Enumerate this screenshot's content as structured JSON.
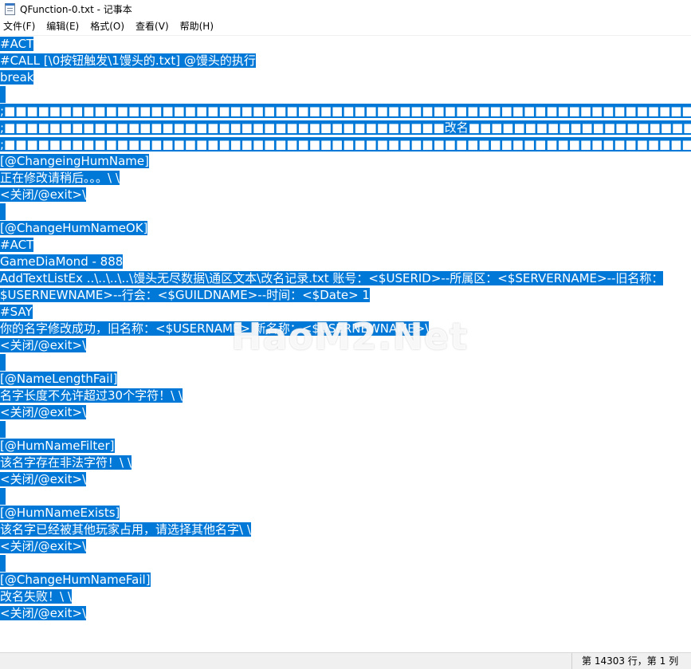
{
  "window": {
    "title": "QFunction-0.txt - 记事本"
  },
  "menu": [
    "文件(F)",
    "编辑(E)",
    "格式(O)",
    "查看(V)",
    "帮助(H)"
  ],
  "lines": [
    "#ACT",
    "#CALL [\\0按钮触发\\1馒头的.txt] @馒头的执行",
    "break",
    "",
    ";■■■■■■■■■■■■■■■■■■■■■■■■■■■■■■■■■■■■■■■■■■■■■■■■■■■■■■■■■■■■■■■■■■■■■■■■■■■■■■■■",
    ";■■■■■■■■■■■■■■■■■■■■■■■■■■■■■■■■■■■■■■■改名■■■■■■■■■■■■■■■■■■■■■■■■■■■■■■■■■■■■■",
    ";■■■■■■■■■■■■■■■■■■■■■■■■■■■■■■■■■■■■■■■■■■■■■■■■■■■■■■■■■■■■■■■■■■■■■■■■■■■■■■■■",
    "[@ChangeingHumName]",
    "正在修改请稍后。。。\\ \\",
    "<关闭/@exit>\\",
    "",
    "[@ChangeHumNameOK]",
    "#ACT",
    "GameDiaMond - 888",
    "AddTextListEx ..\\..\\..\\..\\馒头无尽数据\\通区文本\\改名记录.txt 账号：<$USERID>--所属区：<$SERVERNAME>--旧名称：",
    "$USERNEWNAME>--行会：<$GUILDNAME>--时间：<$Date> 1",
    "#SAY",
    "你的名字修改成功，旧名称：<$USERNAME> 新名称：<$USERNEWNAME>\\",
    "<关闭/@exit>\\",
    "",
    "[@NameLengthFail]",
    "名字长度不允许超过30个字符！\\ \\",
    "<关闭/@exit>\\",
    "",
    "[@HumNameFilter]",
    "该名字存在非法字符！\\ \\",
    "<关闭/@exit>\\",
    "",
    "[@HumNameExists]",
    "该名字已经被其他玩家占用，请选择其他名字\\ \\",
    "<关闭/@exit>\\",
    "",
    "[@ChangeHumNameFail]",
    "改名失败！\\ \\",
    "<关闭/@exit>\\"
  ],
  "watermark": "HaoM2.Net",
  "status": {
    "position": "第 14303 行，第 1 列"
  },
  "colors": {
    "selection": "#0078d7",
    "selection_text": "#ffffff"
  }
}
